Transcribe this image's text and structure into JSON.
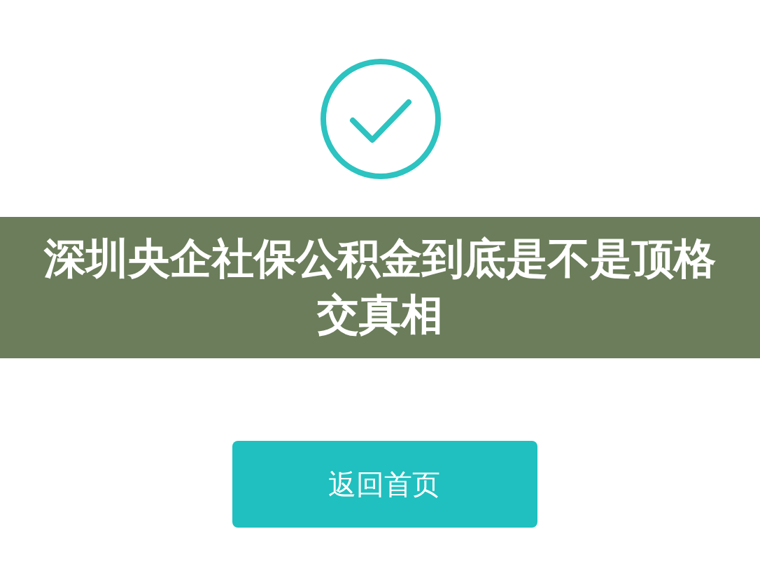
{
  "banner": {
    "title": "深圳央企社保公积金到底是不是顶格交真相"
  },
  "button": {
    "label": "返回首页"
  }
}
